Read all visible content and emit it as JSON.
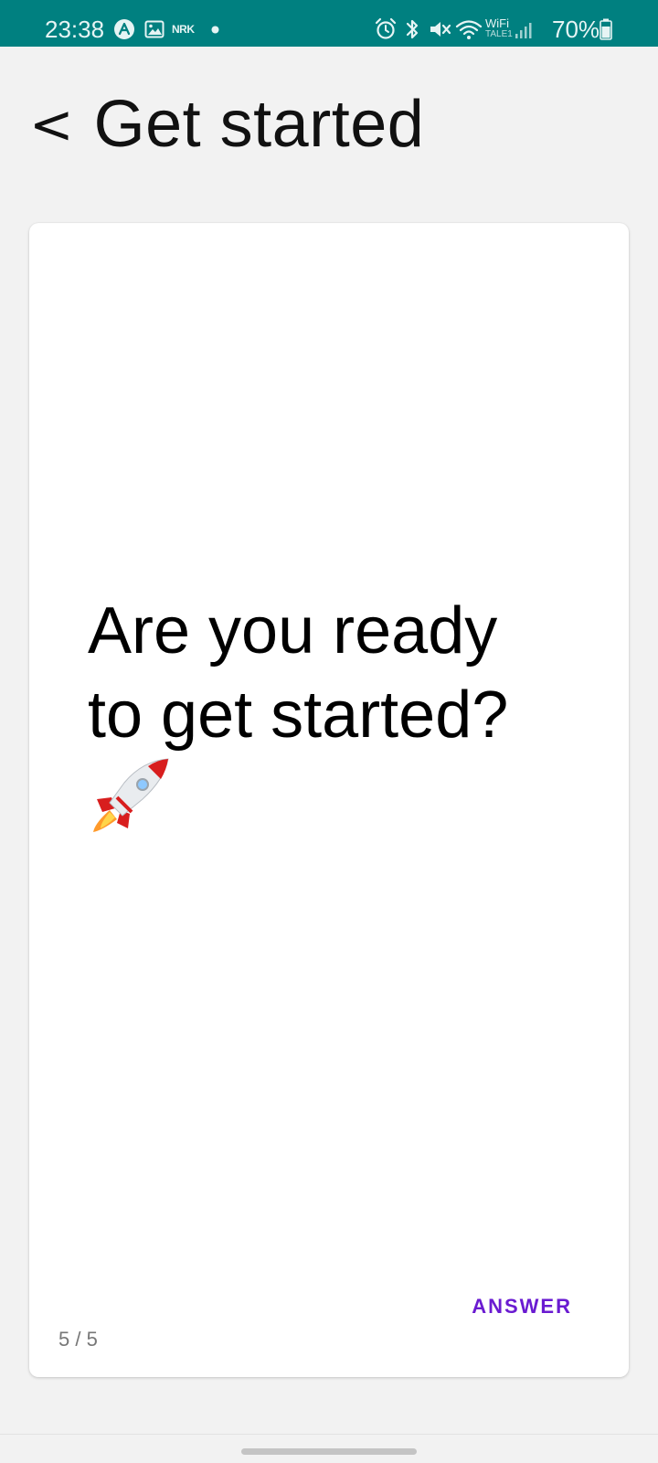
{
  "status_bar": {
    "time": "23:38",
    "battery_percent": "70%",
    "wifi_label_top": "WiFi",
    "wifi_label_bottom": "TALE1",
    "nrk_label": "NRK",
    "icons": [
      "app-a-icon",
      "gallery-icon",
      "nrk-icon",
      "notification-dot-icon",
      "alarm-icon",
      "bluetooth-icon",
      "mute-icon",
      "wifi-icon",
      "signal-icon",
      "battery-icon"
    ],
    "background_color": "#008080"
  },
  "header": {
    "back_label": "<",
    "title": "Get started"
  },
  "card": {
    "question": "Are you ready to get started?",
    "emoji_icon": "rocket-icon",
    "answer_label": "ANSWER",
    "counter": "5 / 5",
    "answer_color": "#6a1bd1"
  },
  "nav": {
    "handle_icon": "home-handle"
  }
}
